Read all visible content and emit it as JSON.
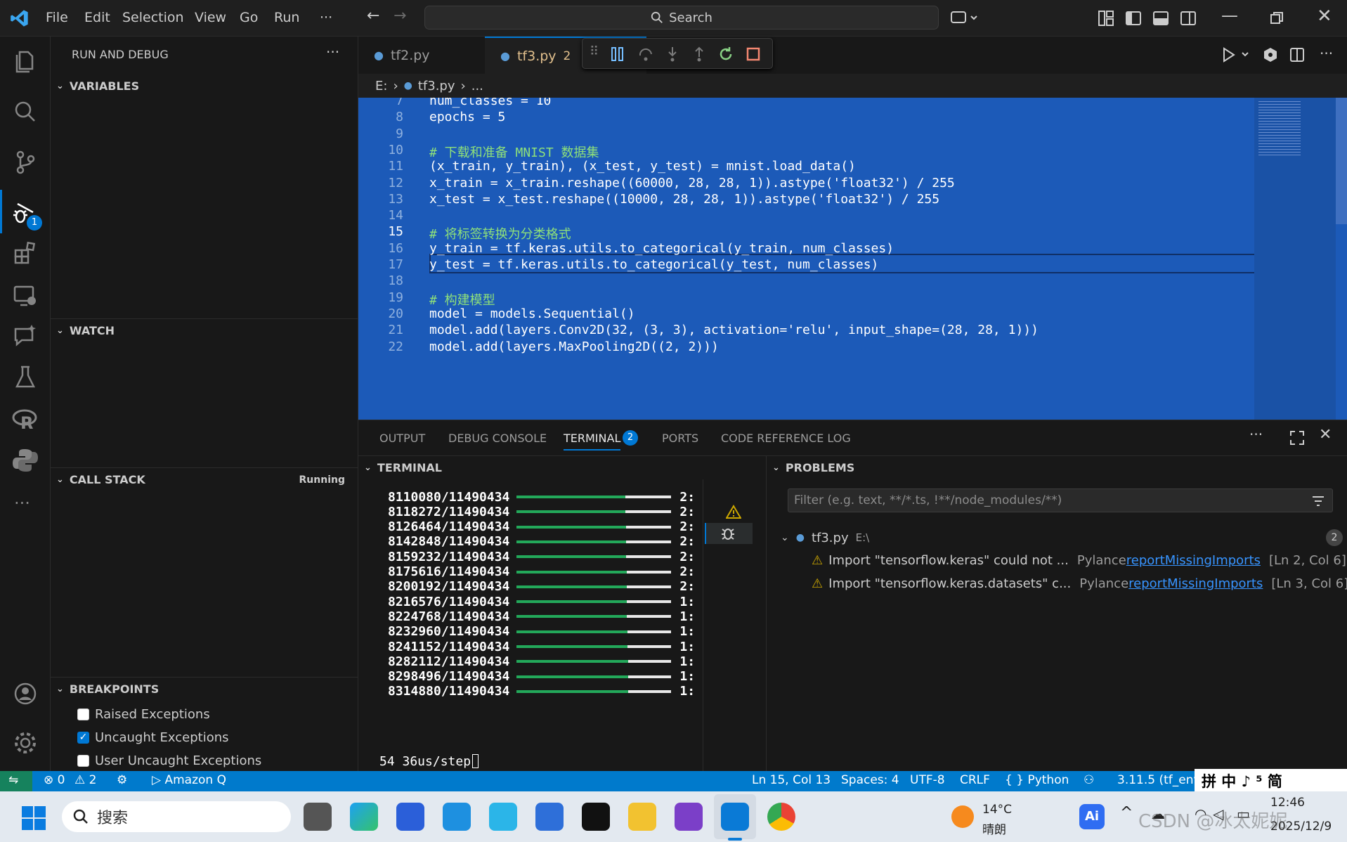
{
  "menu": {
    "file": "File",
    "edit": "Edit",
    "selection": "Selection",
    "view": "View",
    "go": "Go",
    "run": "Run",
    "more": "···"
  },
  "search": {
    "label": "Search"
  },
  "sidebar": {
    "title": "RUN AND DEBUG",
    "variables": "VARIABLES",
    "watch": "WATCH",
    "call_stack": "CALL STACK",
    "call_stack_status": "Running",
    "breakpoints": "BREAKPOINTS",
    "bp_items": [
      {
        "label": "Raised Exceptions",
        "checked": false
      },
      {
        "label": "Uncaught Exceptions",
        "checked": true
      },
      {
        "label": "User Uncaught Exceptions",
        "checked": false
      }
    ],
    "debug_badge": "1"
  },
  "tabs": {
    "tab1": "tf2.py",
    "tab2": "tf3.py",
    "tab2_badge": "2"
  },
  "breadcrumb": {
    "drive": "E:",
    "file": "tf3.py",
    "rest": "..."
  },
  "code": {
    "lines": [
      {
        "n": "7",
        "t": "num_classes = 10"
      },
      {
        "n": "8",
        "t": "epochs = 5"
      },
      {
        "n": "9",
        "t": ""
      },
      {
        "n": "10",
        "t": "# 下载和准备 MNIST 数据集"
      },
      {
        "n": "11",
        "t": "(x_train, y_train), (x_test, y_test) = mnist.load_data()"
      },
      {
        "n": "12",
        "t": "x_train = x_train.reshape((60000, 28, 28, 1)).astype('float32') / 255"
      },
      {
        "n": "13",
        "t": "x_test = x_test.reshape((10000, 28, 28, 1)).astype('float32') / 255"
      },
      {
        "n": "14",
        "t": ""
      },
      {
        "n": "15",
        "t": "# 将标签转换为分类格式"
      },
      {
        "n": "16",
        "t": "y_train = tf.keras.utils.to_categorical(y_train, num_classes)"
      },
      {
        "n": "17",
        "t": "y_test = tf.keras.utils.to_categorical(y_test, num_classes)"
      },
      {
        "n": "18",
        "t": ""
      },
      {
        "n": "19",
        "t": "# 构建模型"
      },
      {
        "n": "20",
        "t": "model = models.Sequential()"
      },
      {
        "n": "21",
        "t": "model.add(layers.Conv2D(32, (3, 3), activation='relu', input_shape=(28, 28, 1)))"
      },
      {
        "n": "22",
        "t": "model.add(layers.MaxPooling2D((2, 2)))"
      }
    ]
  },
  "panel": {
    "tabs": [
      "OUTPUT",
      "DEBUG CONSOLE",
      "TERMINAL",
      "PORTS",
      "CODE REFERENCE LOG"
    ],
    "terminal_badge": "2",
    "terminal_header": "TERMINAL",
    "problems_header": "PROBLEMS",
    "filter_placeholder": "Filter (e.g. text, **/*.ts, !**/node_modules/**)",
    "problem_file": "tf3.py",
    "problem_path": "E:\\",
    "problem_count": "2",
    "problems": [
      {
        "msg": "Import \"tensorflow.keras\" could not ...",
        "source": "Pylance",
        "rule": "reportMissingImports",
        "loc": "[Ln 2, Col 6]"
      },
      {
        "msg": "Import \"tensorflow.keras.datasets\" c...",
        "source": "Pylance",
        "rule": "reportMissingImports",
        "loc": "[Ln 3, Col 6]"
      }
    ]
  },
  "terminal_rows": [
    {
      "text": "8110080/11490434",
      "eta": "2:"
    },
    {
      "text": "8118272/11490434",
      "eta": "2:"
    },
    {
      "text": "8126464/11490434",
      "eta": "2:"
    },
    {
      "text": "8142848/11490434",
      "eta": "2:"
    },
    {
      "text": "8159232/11490434",
      "eta": "2:"
    },
    {
      "text": "8175616/11490434",
      "eta": "2:"
    },
    {
      "text": "8200192/11490434",
      "eta": "2:"
    },
    {
      "text": "8216576/11490434",
      "eta": "1:"
    },
    {
      "text": "8224768/11490434",
      "eta": "1:"
    },
    {
      "text": "8232960/11490434",
      "eta": "1:"
    },
    {
      "text": "8241152/11490434",
      "eta": "1:"
    },
    {
      "text": "8282112/11490434",
      "eta": "1:"
    },
    {
      "text": "8298496/11490434",
      "eta": "1:"
    },
    {
      "text": "8314880/11490434",
      "eta": "1:"
    }
  ],
  "terminal_last": "54 36us/step",
  "status": {
    "errors": "0",
    "warnings": "2",
    "amazon": "Amazon Q",
    "position": "Ln 15, Col 13",
    "spaces": "Spaces: 4",
    "encoding": "UTF-8",
    "eol": "CRLF",
    "language": "Python",
    "interpreter": "3.11.5 (tf_env"
  },
  "ime": "拼 中 ♪ ⁵ 简",
  "taskbar": {
    "search": "搜索",
    "temp": "14°C",
    "weather": "晴朗",
    "time": "12:46",
    "date": "2025/12/9",
    "watermark": "CSDN @冰太妮妮"
  },
  "colors": {
    "accent": "#007acc",
    "selection": "#1c5ab8",
    "progress": "#23a85a",
    "warning": "#cca700"
  }
}
